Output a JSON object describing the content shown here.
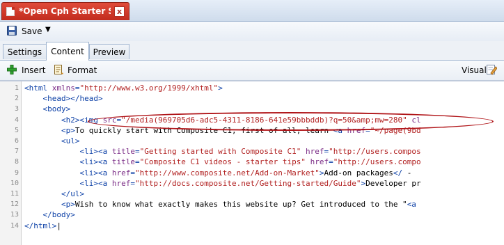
{
  "doc_tab": {
    "title": "*Open Cph Starter S",
    "close": "x"
  },
  "toolbar": {
    "save_label": "Save",
    "save_dropdown": "▼"
  },
  "view_tabs": [
    "Settings",
    "Content",
    "Preview"
  ],
  "edit_toolbar": {
    "insert_label": "Insert",
    "format_label": "Format",
    "visual_label": "Visual"
  },
  "editor": {
    "line_numbers": [
      "1",
      "2",
      "3",
      "4",
      "5",
      "6",
      "7",
      "8",
      "9",
      "10",
      "11",
      "12",
      "13",
      "14"
    ],
    "lines": [
      [
        [
          "tag",
          "<html "
        ],
        [
          "attr",
          "xmlns"
        ],
        [
          "tag",
          "="
        ],
        [
          "str",
          "\"http://www.w3.org/1999/xhtml\""
        ],
        [
          "tag",
          ">"
        ]
      ],
      [
        [
          "text",
          "    "
        ],
        [
          "tag",
          "<head></head>"
        ]
      ],
      [
        [
          "text",
          "    "
        ],
        [
          "tag",
          "<body>"
        ]
      ],
      [
        [
          "text",
          "        "
        ],
        [
          "tag",
          "<h2>"
        ],
        [
          "tag",
          "<img "
        ],
        [
          "attr",
          "src"
        ],
        [
          "tag",
          "="
        ],
        [
          "str",
          "\"/media(969705d6-adc5-4311-8186-641e59bbbddb)?q=50&amp;mw=280\""
        ],
        [
          "text",
          " "
        ],
        [
          "attr",
          "cl"
        ]
      ],
      [
        [
          "text",
          "        "
        ],
        [
          "tag",
          "<p>"
        ],
        [
          "text",
          "To quickly start with Composite C1, first of all, learn "
        ],
        [
          "tag",
          "<a "
        ],
        [
          "attr",
          "href"
        ],
        [
          "tag",
          "="
        ],
        [
          "str",
          "\"~/page(9bd"
        ]
      ],
      [
        [
          "text",
          "        "
        ],
        [
          "tag",
          "<ul>"
        ]
      ],
      [
        [
          "text",
          "            "
        ],
        [
          "tag",
          "<li><a "
        ],
        [
          "attr",
          "title"
        ],
        [
          "tag",
          "="
        ],
        [
          "str",
          "\"Getting started with Composite C1\""
        ],
        [
          "text",
          " "
        ],
        [
          "attr",
          "href"
        ],
        [
          "tag",
          "="
        ],
        [
          "str",
          "\"http://users.compos"
        ]
      ],
      [
        [
          "text",
          "            "
        ],
        [
          "tag",
          "<li><a "
        ],
        [
          "attr",
          "title"
        ],
        [
          "tag",
          "="
        ],
        [
          "str",
          "\"Composite C1 videos - starter tips\""
        ],
        [
          "text",
          " "
        ],
        [
          "attr",
          "href"
        ],
        [
          "tag",
          "="
        ],
        [
          "str",
          "\"http://users.compo"
        ]
      ],
      [
        [
          "text",
          "            "
        ],
        [
          "tag",
          "<li><a "
        ],
        [
          "attr",
          "href"
        ],
        [
          "tag",
          "="
        ],
        [
          "str",
          "\"http://www.composite.net/Add-on-Market\""
        ],
        [
          "tag",
          ">"
        ],
        [
          "text",
          "Add-on packages"
        ],
        [
          "tag",
          "</"
        ],
        [
          "text",
          " -"
        ]
      ],
      [
        [
          "text",
          "            "
        ],
        [
          "tag",
          "<li><a "
        ],
        [
          "attr",
          "href"
        ],
        [
          "tag",
          "="
        ],
        [
          "str",
          "\"http://docs.composite.net/Getting-started/Guide\""
        ],
        [
          "tag",
          ">"
        ],
        [
          "text",
          "Developer pr"
        ]
      ],
      [
        [
          "text",
          "        "
        ],
        [
          "tag",
          "</ul>"
        ]
      ],
      [
        [
          "text",
          "        "
        ],
        [
          "tag",
          "<p>"
        ],
        [
          "text",
          "Wish to know what exactly makes this website up? Get introduced to the \""
        ],
        [
          "tag",
          "<a"
        ]
      ],
      [
        [
          "text",
          "    "
        ],
        [
          "tag",
          "</body>"
        ]
      ],
      [
        [
          "tag",
          "</html>"
        ],
        [
          "text",
          "|"
        ]
      ]
    ]
  },
  "colors": {
    "tab_red": "#c22c1e",
    "tag_blue": "#0b3fa6",
    "attr_purple": "#7a2b86",
    "string_red": "#b22222",
    "highlight_red": "#b01418"
  }
}
